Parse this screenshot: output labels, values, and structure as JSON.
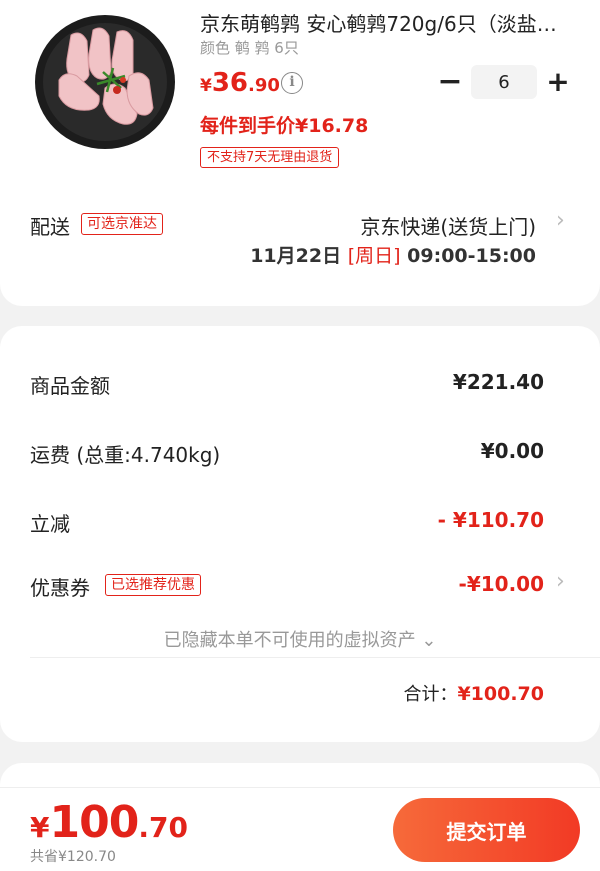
{
  "product": {
    "title": "京东萌鹌鹑 安心鹌鹑720g/6只（淡盐…",
    "spec": "颜色 鹌 鹑 6只",
    "price_symbol": "¥",
    "price_integer": "36",
    "price_decimal": ".90",
    "info_icon": "info-icon",
    "quantity": "6",
    "minus_label": "−",
    "plus_label": "+",
    "unit_price": "每件到手价¥16.78",
    "return_badge": "不支持7天无理由退货"
  },
  "delivery": {
    "label": "配送",
    "badge": "可选京准达",
    "method": "京东快递(送货上门)",
    "date": "11月22日",
    "weekday": "[周日]",
    "time": "09:00-15:00"
  },
  "summary": {
    "goods_label": "商品金额",
    "goods_value": "¥221.40",
    "shipping_label": "运费 (总重:4.740kg)",
    "shipping_value": "¥0.00",
    "discount_label": "立减",
    "discount_value": "- ¥110.70",
    "coupon_label": "优惠券",
    "coupon_badge": "已选推荐优惠",
    "coupon_value": "-¥10.00",
    "hidden_assets": "已隐藏本单不可使用的虚拟资产",
    "total_label": "合计：",
    "total_value": "¥100.70"
  },
  "footer": {
    "price_symbol": "¥",
    "price_integer": "100",
    "price_decimal": ".70",
    "saved": "共省¥120.70",
    "submit": "提交订单"
  },
  "colors": {
    "accent": "#e2231a",
    "button_start": "#f66a3a",
    "button_end": "#f23a25"
  }
}
